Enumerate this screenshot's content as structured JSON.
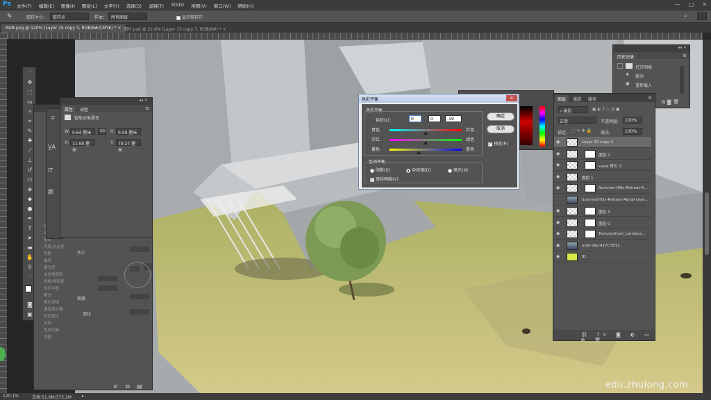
{
  "menubar": {
    "app_label": "Ps",
    "menus": [
      "文件(F)",
      "编辑(E)",
      "图像(I)",
      "图层(L)",
      "文字(Y)",
      "选择(S)",
      "滤镜(T)",
      "3D(D)",
      "视图(V)",
      "窗口(W)",
      "帮助(H)"
    ],
    "win_minimize": "—",
    "win_restore": "□",
    "win_close": "✕"
  },
  "options": {
    "tool_icon": "eyedropper-icon",
    "sample_size_label": "取样大小：",
    "sample_size_value": "取样点",
    "sample_label": "样本：",
    "sample_value": "所有图层",
    "show_ring_label": "显示取样环"
  },
  "tabs": {
    "active": "RGB.png @ 120% (Layer 15 copy 3, RGB/8#/CMYK) * ×",
    "inactive": "图片.psd @ 22.8% (Layer 15 copy 3, RGB/8#) * ×"
  },
  "status": {
    "zoom": "120.1%",
    "doc": "文档:51.6M/372.2M"
  },
  "watermark": "edu.zhulong.com",
  "properties_panel": {
    "tab1": "属性",
    "tab2": "调整",
    "subtitle": "智能对象属性",
    "w_label": "W:",
    "w_value": "0.64 厘米",
    "h_label": "H:",
    "h_value": "0.59 厘米",
    "x_label": "X:",
    "x_value": "11.99 厘米",
    "y_label": "Y:",
    "y_value": "79.27 厘米",
    "link_label": "GO"
  },
  "background_panel": {
    "items": [
      "颜色",
      "渐变",
      "图案",
      "亮度/对比度",
      "色阶",
      "曲线",
      "曝光度",
      "自然饱和度",
      "色相/饱和度",
      "色彩平衡",
      "黑白",
      "照片滤镜",
      "通道混合器",
      "颜色查找",
      "反相",
      "色调分离",
      "阈值"
    ],
    "size_label": "大小",
    "density_label": "密度",
    "feather_label": "羽化"
  },
  "color_balance": {
    "title": "色彩平衡",
    "group_label": "色彩平衡",
    "levels_label": "色阶(L):",
    "level1": "0",
    "level2": "0",
    "level3": "-19",
    "cyan": "青色",
    "red": "红色",
    "magenta": "洋红",
    "green": "绿色",
    "yellow": "黄色",
    "blue": "蓝色",
    "ok": "确定",
    "cancel": "取消",
    "preview": "预览(P)",
    "tone_group": "色调平衡",
    "shadows": "阴影(S)",
    "midtones": "中间调(D)",
    "highlights": "高光(H)",
    "preserve": "保持明度(V)",
    "cyan_red_level": 0,
    "magenta_green_level": 0,
    "yellow_blue_level": -19
  },
  "history_panel": {
    "title": "历史记录",
    "items": [
      "打开网格",
      "移动",
      "重新载入"
    ]
  },
  "layers_panel": {
    "tab1": "图层",
    "tab2": "通道",
    "tab3": "路径",
    "kind_label": "类型",
    "blend_mode": "正常",
    "opacity_label": "不透明度:",
    "opacity_value": "100%",
    "lock_label": "锁定:",
    "fill_label": "填充:",
    "fill_value": "100%",
    "layers": [
      {
        "name": "Layer 15 copy 3",
        "visible": true,
        "selected": true,
        "type": "plain"
      },
      {
        "name": "图层 2",
        "visible": true,
        "selected": false,
        "type": "mask"
      },
      {
        "name": "sucai 拷贝 3",
        "visible": true,
        "selected": false,
        "type": "mask"
      },
      {
        "name": "图层 1",
        "visible": true,
        "selected": false,
        "type": "plain"
      },
      {
        "name": "Summer-Hills-Retreat-A...",
        "visible": true,
        "selected": false,
        "type": "mask"
      },
      {
        "name": "SummerHills-Retreat-Aerial-User...",
        "visible": false,
        "selected": false,
        "type": "photo"
      },
      {
        "name": "图层 3",
        "visible": true,
        "selected": false,
        "type": "mask"
      },
      {
        "name": "图层 0",
        "visible": true,
        "selected": false,
        "type": "mask"
      },
      {
        "name": "TexturesCom_Landsca...",
        "visible": true,
        "selected": false,
        "type": "mask"
      },
      {
        "name": "utah-sky-417C7811",
        "visible": true,
        "selected": false,
        "type": "photo"
      },
      {
        "name": "ID",
        "visible": true,
        "selected": false,
        "type": "color"
      }
    ]
  }
}
